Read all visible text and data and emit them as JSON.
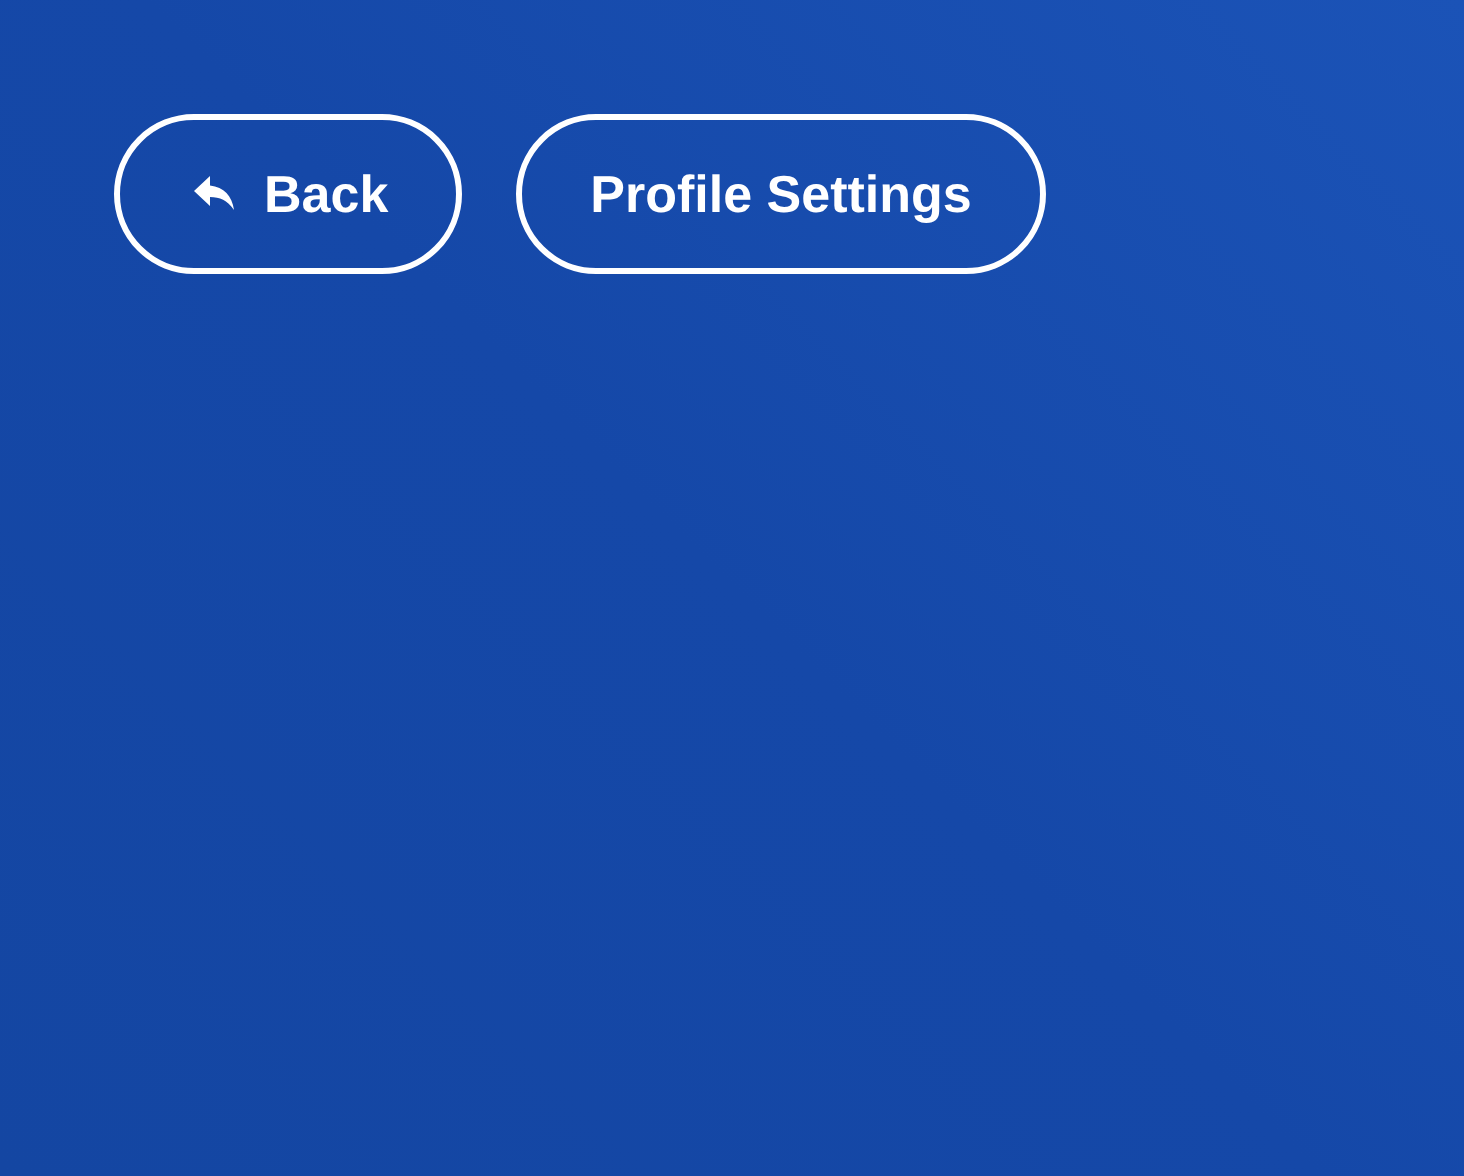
{
  "buttons": [
    {
      "label": "Back",
      "kind": "back"
    },
    {
      "label": "Profile Settings",
      "kind": "plain"
    }
  ]
}
